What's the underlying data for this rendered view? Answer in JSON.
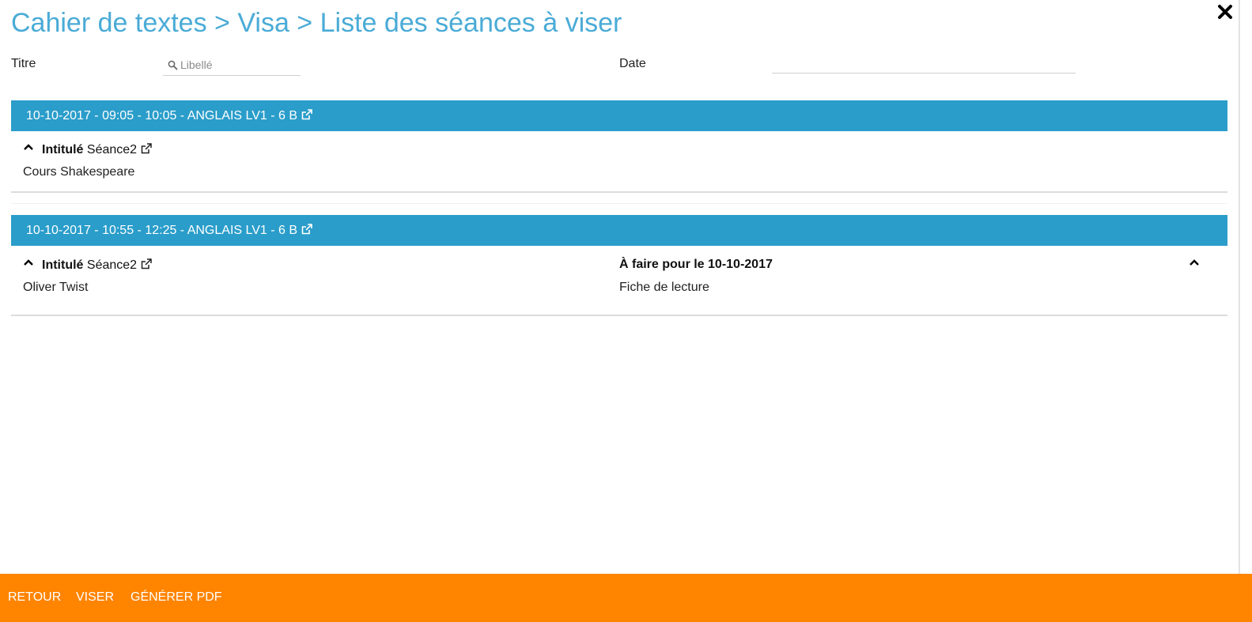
{
  "header": {
    "title": "Cahier de textes > Visa > Liste des séances à viser",
    "close_icon": "close-icon"
  },
  "filters": {
    "titre_label": "Titre",
    "titre_placeholder": "Libellé",
    "titre_value": "",
    "date_label": "Date",
    "date_value": ""
  },
  "seances": [
    {
      "header": "10-10-2017 - 09:05 - 10:05 - ANGLAIS LV1 - 6 B",
      "intitule_label": "Intitulé",
      "intitule_value": "Séance2",
      "content": "Cours Shakespeare"
    },
    {
      "header": "10-10-2017 - 10:55 - 12:25 - ANGLAIS LV1 - 6 B",
      "intitule_label": "Intitulé",
      "intitule_value": "Séance2",
      "content": "Oliver Twist",
      "devoir_title": "À faire pour le 10-10-2017",
      "devoir_content": "Fiche de lecture"
    }
  ],
  "footer": {
    "retour": "RETOUR",
    "viser": "VISER",
    "generer_pdf": "GÉNÉRER PDF"
  },
  "colors": {
    "title": "#4aabd6",
    "seance_header": "#2a9dca",
    "footer": "#ff8400"
  }
}
